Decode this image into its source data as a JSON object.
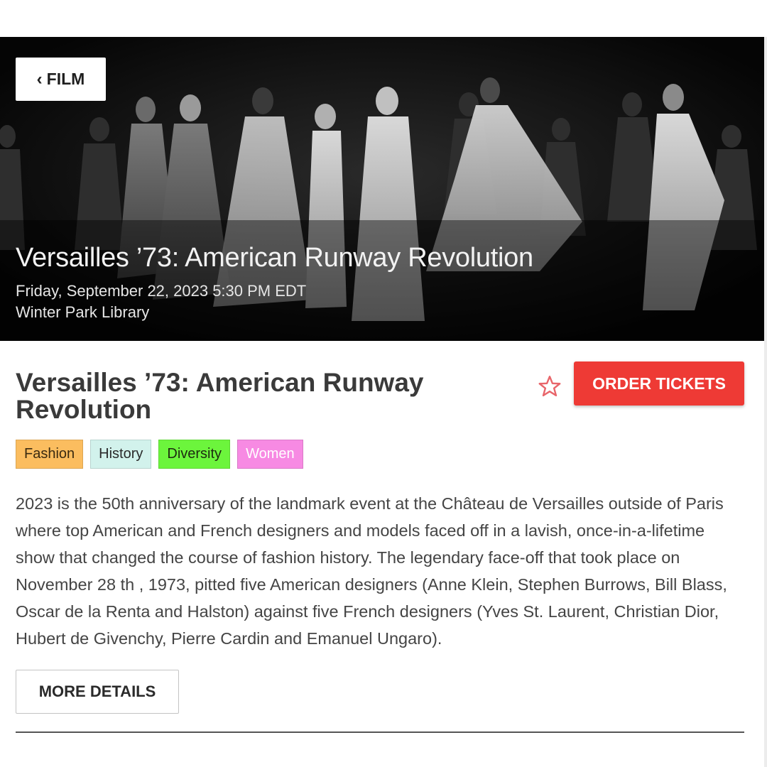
{
  "hero": {
    "back_label": "FILM",
    "title": "Versailles ’73: American Runway Revolution",
    "datetime": "Friday, September 22, 2023 5:30 PM EDT",
    "venue": "Winter Park Library"
  },
  "event": {
    "title": "Versailles ’73: American Runway Revolution",
    "order_label": "ORDER TICKETS",
    "tags": [
      "Fashion",
      "History",
      "Diversity",
      "Women"
    ],
    "description": "2023 is the 50th anniversary of the landmark event at the Château de Versailles outside of Paris where top American and French designers and models faced off in a lavish, once-in-a-lifetime show that changed the course of fashion history. The legendary face-off that took place on November 28 th , 1973, pitted five American designers (Anne Klein, Stephen Burrows, Bill Blass, Oscar de la Renta and Halston) against five French designers (Yves St. Laurent, Christian Dior, Hubert de Givenchy, Pierre Cardin and Emanuel Ungaro).",
    "more_label": "MORE DETAILS"
  },
  "colors": {
    "order_button": "#ee3a35",
    "favorite_star": "#e8656a",
    "tag_fashion": "#fbbd5f",
    "tag_history": "#d2f2ec",
    "tag_diversity": "#6cf53c",
    "tag_women": "#f78ae3"
  },
  "icons": {
    "back": "chevron-left-icon",
    "favorite": "star-outline-icon"
  }
}
